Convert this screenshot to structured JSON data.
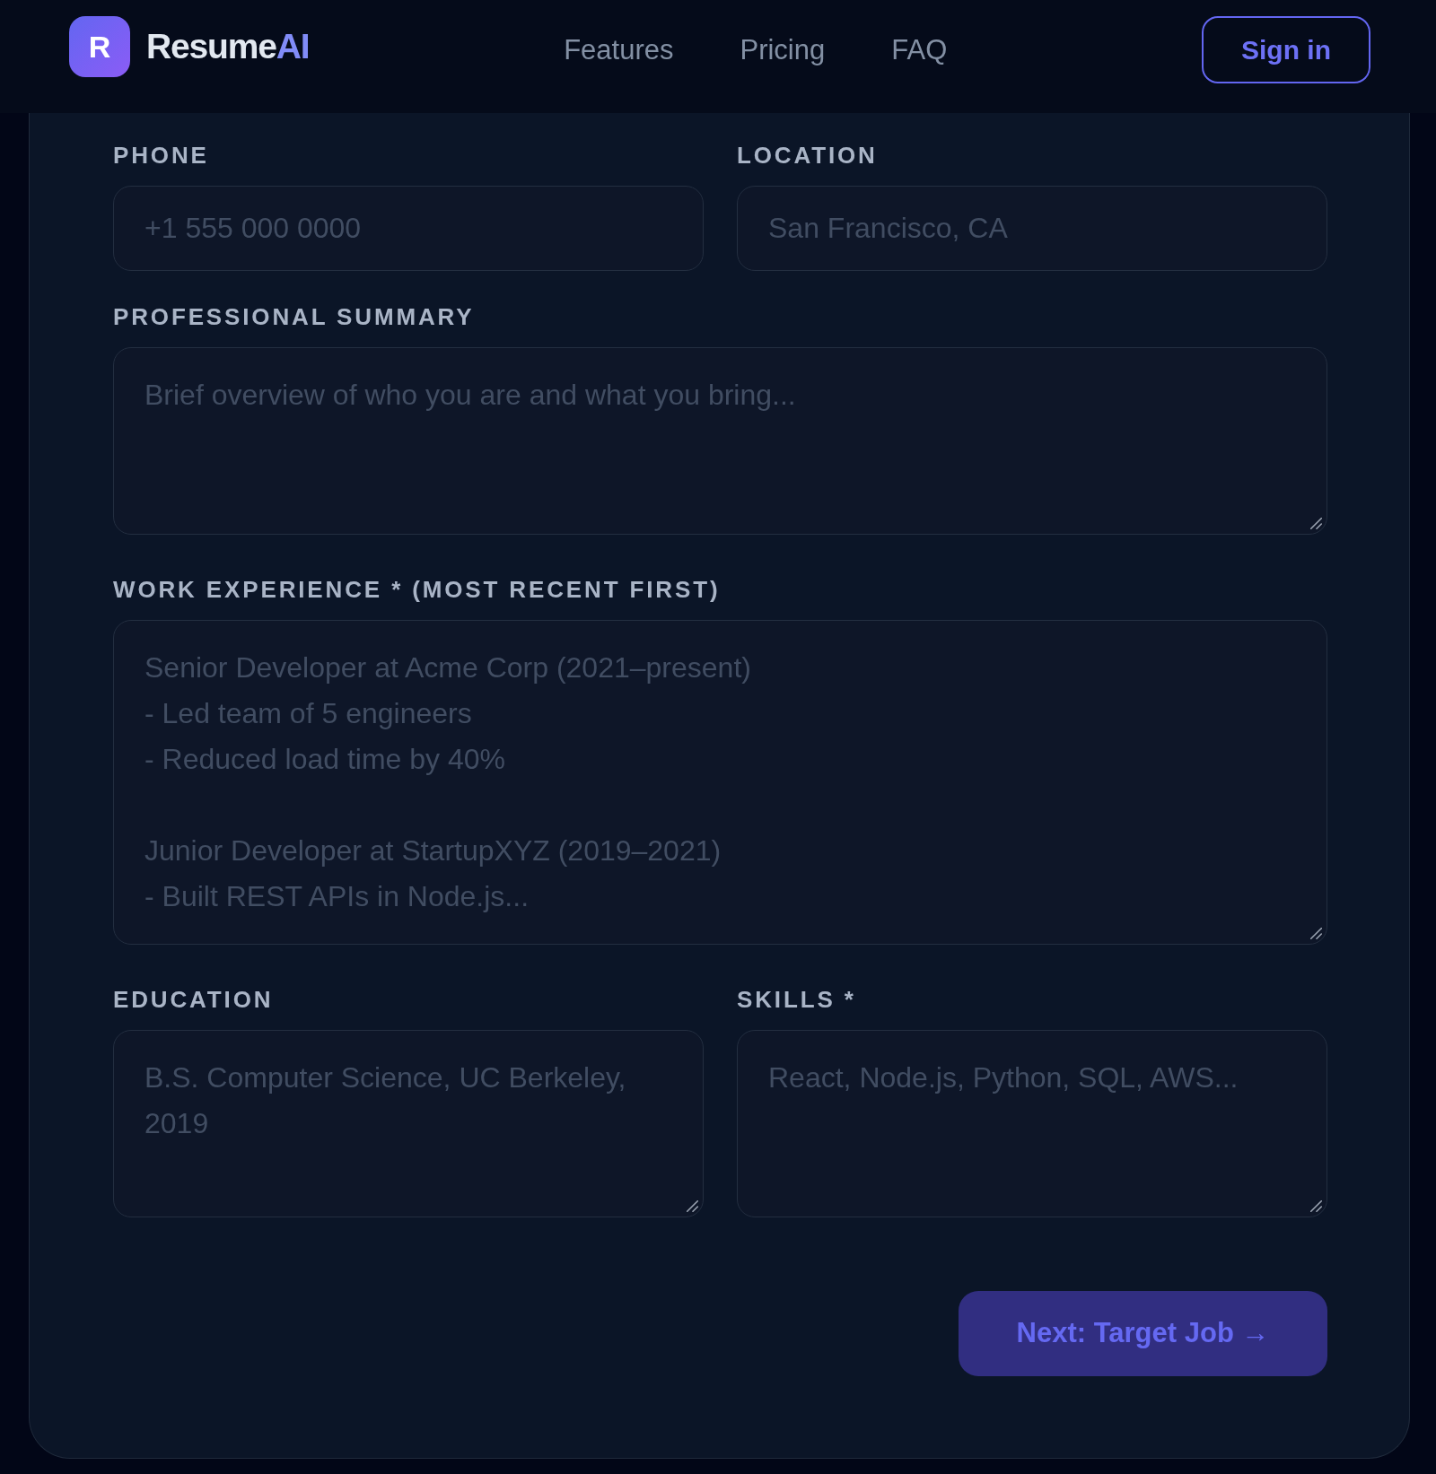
{
  "header": {
    "logo_mark": "R",
    "brand": {
      "name": "Resume",
      "accent": "AI"
    },
    "nav_links": [
      "Features",
      "Pricing",
      "FAQ"
    ],
    "sign_in": "Sign in"
  },
  "form": {
    "rows": [
      {
        "fields": [
          {
            "kind": "input",
            "label": "PHONE",
            "placeholder": "+1 555 000 0000"
          },
          {
            "kind": "input",
            "label": "LOCATION",
            "placeholder": "San Francisco, CA"
          }
        ]
      },
      {
        "fields": [
          {
            "kind": "textarea",
            "label": "PROFESSIONAL SUMMARY",
            "placeholder": "Brief overview of who you are and what you bring..."
          }
        ]
      },
      {
        "fields": [
          {
            "kind": "textarea",
            "label": "WORK EXPERIENCE * (MOST RECENT FIRST)",
            "placeholder": "Senior Developer at Acme Corp (2021–present)\n- Led team of 5 engineers\n- Reduced load time by 40%\n\nJunior Developer at StartupXYZ (2019–2021)\n- Built REST APIs in Node.js..."
          }
        ]
      },
      {
        "fields": [
          {
            "kind": "textarea",
            "label": "EDUCATION",
            "placeholder": "B.S. Computer Science, UC Berkeley, 2019"
          },
          {
            "kind": "textarea",
            "label": "SKILLS *",
            "placeholder": "React, Node.js, Python, SQL, AWS..."
          }
        ]
      }
    ],
    "next_button": "Next: Target Job →"
  }
}
